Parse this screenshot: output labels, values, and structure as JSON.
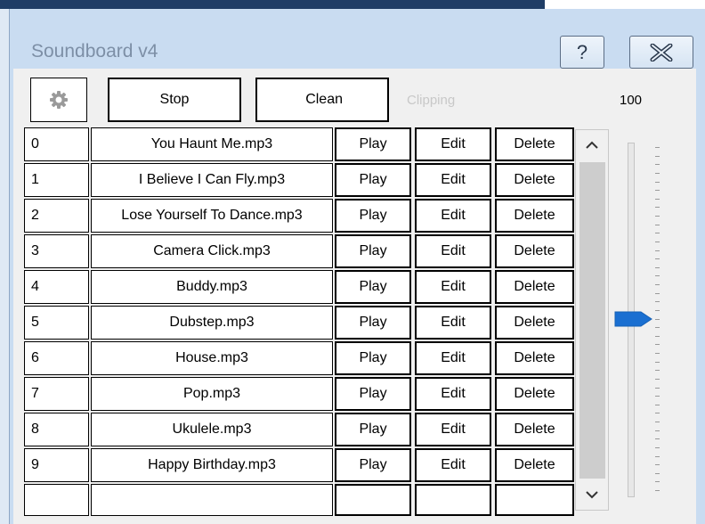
{
  "window": {
    "title": "Soundboard v4",
    "help_label": "?",
    "close_icon": "close-x-icon"
  },
  "toolbar": {
    "settings_icon": "gear-icon",
    "stop_label": "Stop",
    "clean_label": "Clean",
    "clipping_label": "Clipping",
    "volume_value": "100"
  },
  "columns": {
    "play_label": "Play",
    "edit_label": "Edit",
    "delete_label": "Delete"
  },
  "sounds": [
    {
      "index": "0",
      "name": "You Haunt Me.mp3"
    },
    {
      "index": "1",
      "name": "I Believe I Can Fly.mp3"
    },
    {
      "index": "2",
      "name": "Lose Yourself To Dance.mp3"
    },
    {
      "index": "3",
      "name": "Camera Click.mp3"
    },
    {
      "index": "4",
      "name": "Buddy.mp3"
    },
    {
      "index": "5",
      "name": "Dubstep.mp3"
    },
    {
      "index": "6",
      "name": "House.mp3"
    },
    {
      "index": "7",
      "name": "Pop.mp3"
    },
    {
      "index": "8",
      "name": "Ukulele.mp3"
    },
    {
      "index": "9",
      "name": "Happy Birthday.mp3"
    }
  ],
  "volume_slider": {
    "value": 100,
    "min": 0,
    "max": 200,
    "thumb_color": "#1a6fd1"
  },
  "colors": {
    "clipping_inactive": "#c8c8c8",
    "accent": "#1a6fd1"
  }
}
